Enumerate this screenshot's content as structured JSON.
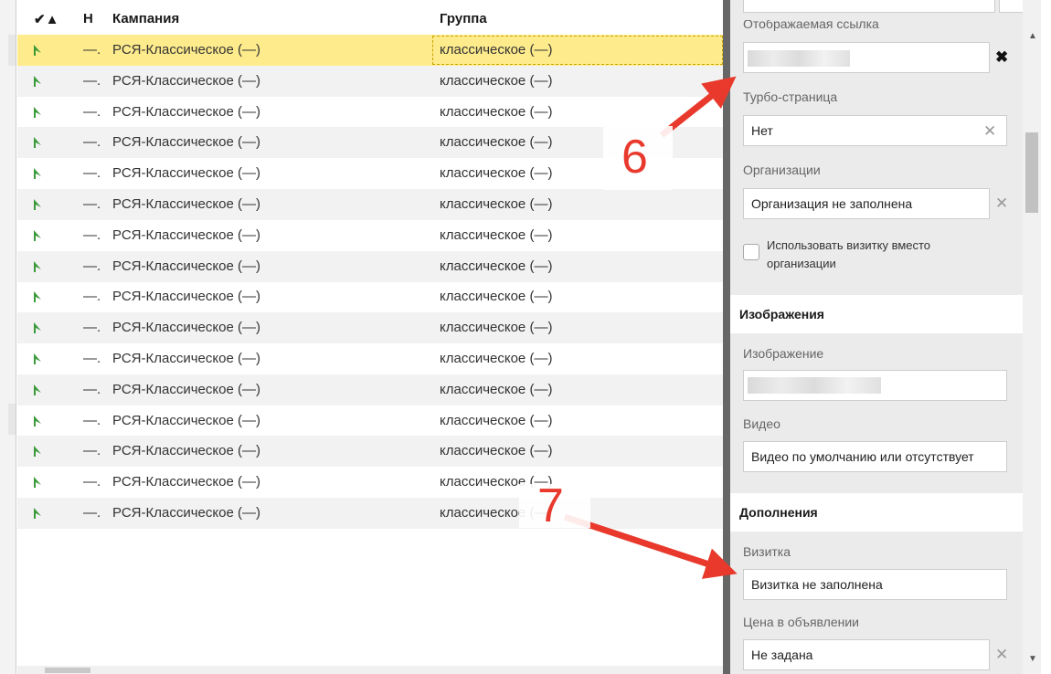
{
  "grid": {
    "headers": {
      "flag_col": "✔▲",
      "num_col": "Н",
      "campaign": "Кампания",
      "group": "Группа"
    },
    "rows": [
      {
        "dash": "—.",
        "campaign": "РСЯ-Классическое (—)",
        "group": "классическое (—)"
      },
      {
        "dash": "—.",
        "campaign": "РСЯ-Классическое (—)",
        "group": "классическое (—)"
      },
      {
        "dash": "—.",
        "campaign": "РСЯ-Классическое (—)",
        "group": "классическое (—)"
      },
      {
        "dash": "—.",
        "campaign": "РСЯ-Классическое (—)",
        "group": "классическое (—)"
      },
      {
        "dash": "—.",
        "campaign": "РСЯ-Классическое (—)",
        "group": "классическое (—)"
      },
      {
        "dash": "—.",
        "campaign": "РСЯ-Классическое (—)",
        "group": "классическое (—)"
      },
      {
        "dash": "—.",
        "campaign": "РСЯ-Классическое (—)",
        "group": "классическое (—)"
      },
      {
        "dash": "—.",
        "campaign": "РСЯ-Классическое (—)",
        "group": "классическое (—)"
      },
      {
        "dash": "—.",
        "campaign": "РСЯ-Классическое (—)",
        "group": "классическое (—)"
      },
      {
        "dash": "—.",
        "campaign": "РСЯ-Классическое (—)",
        "group": "классическое (—)"
      },
      {
        "dash": "—.",
        "campaign": "РСЯ-Классическое (—)",
        "group": "классическое (—)"
      },
      {
        "dash": "—.",
        "campaign": "РСЯ-Классическое (—)",
        "group": "классическое (—)"
      },
      {
        "dash": "—.",
        "campaign": "РСЯ-Классическое (—)",
        "group": "классическое (—)"
      },
      {
        "dash": "—.",
        "campaign": "РСЯ-Классическое (—)",
        "group": "классическое (—)"
      },
      {
        "dash": "—.",
        "campaign": "РСЯ-Классическое (—)",
        "group": "классическое (—)"
      },
      {
        "dash": "—.",
        "campaign": "РСЯ-Классическое (—)",
        "group": "классическое (—)"
      }
    ]
  },
  "panel": {
    "display_link_label": "Отображаемая ссылка",
    "turbo_label": "Турбо-страница",
    "turbo_value": "Нет",
    "org_label": "Организации",
    "org_value": "Организация не заполнена",
    "use_vcard_label": "Использовать визитку вместо организации",
    "images_section": "Изображения",
    "image_label": "Изображение",
    "video_label": "Видео",
    "video_value": "Видео по умолчанию или отсутствует",
    "extensions_section": "Дополнения",
    "vcard_label": "Визитка",
    "vcard_value": "Визитка не заполнена",
    "price_label": "Цена в объявлении",
    "price_value": "Не задана",
    "clear_glyph": "✕",
    "remove_glyph": "✖"
  },
  "annotations": {
    "note_6": "6",
    "note_7": "7"
  },
  "colors": {
    "selected_row": "#fdeb8c",
    "arrow": "#e8392c",
    "flag": "#3a9a3a"
  },
  "icons": {
    "row_flag": "green-flag-icon",
    "clear": "close-icon",
    "scroll_up": "arrow-up-icon",
    "scroll_down": "arrow-down-icon"
  }
}
